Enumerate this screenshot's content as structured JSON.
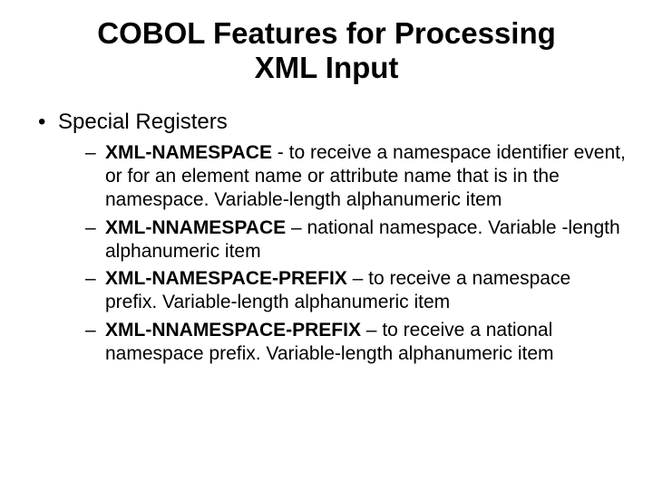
{
  "title": "COBOL Features for Processing XML Input",
  "section": "Special Registers",
  "items": [
    {
      "term": "XML-NAMESPACE",
      "sep": " - ",
      "desc": "to receive a namespace identifier event, or for an element name or attribute name that is in the namespace.  Variable-length alphanumeric item"
    },
    {
      "term": "XML-NNAMESPACE",
      "sep": " – ",
      "desc": "national namespace. Variable -length alphanumeric item"
    },
    {
      "term": "XML-NAMESPACE-PREFIX",
      "sep": " – ",
      "desc": "to receive a namespace prefix. Variable-length alphanumeric item"
    },
    {
      "term": "XML-NNAMESPACE-PREFIX",
      "sep": " – ",
      "desc": "to receive a national namespace prefix. Variable-length alphanumeric item"
    }
  ]
}
